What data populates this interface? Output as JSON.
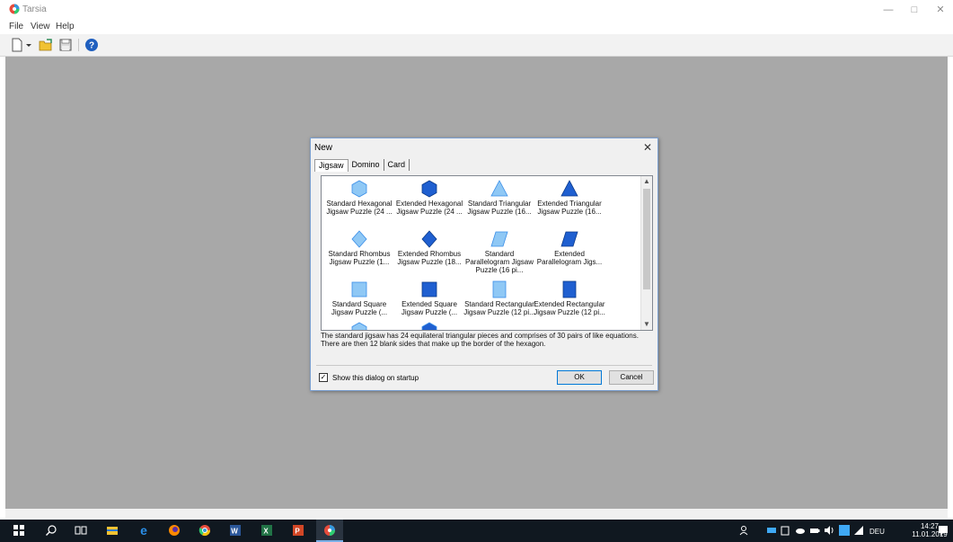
{
  "window": {
    "title": "Tarsia",
    "minimize": "—",
    "maximize": "□",
    "close": "✕"
  },
  "menu": [
    "File",
    "View",
    "Help"
  ],
  "toolbar": {
    "icons": [
      "new-document-icon",
      "dropdown-arrow-icon",
      "open-folder-icon",
      "save-icon",
      "help-icon"
    ]
  },
  "dialog": {
    "title": "New",
    "close": "✕",
    "tabs": [
      "Jigsaw",
      "Domino",
      "Card"
    ],
    "active_tab": "Jigsaw",
    "items": [
      {
        "label": "Standard Hexagonal Jigsaw Puzzle (24 ...",
        "icon": "hexagon-small-icon"
      },
      {
        "label": "Extended Hexagonal Jigsaw Puzzle (24 ...",
        "icon": "hexagon-large-icon"
      },
      {
        "label": "Standard Triangular Jigsaw Puzzle (16...",
        "icon": "triangle-small-icon"
      },
      {
        "label": "Extended Triangular Jigsaw Puzzle (16...",
        "icon": "triangle-large-icon"
      },
      {
        "label": "Standard Rhombus Jigsaw Puzzle (1...",
        "icon": "rhombus-small-icon"
      },
      {
        "label": "Extended Rhombus Jigsaw Puzzle (18...",
        "icon": "rhombus-large-icon"
      },
      {
        "label": "Standard Parallelogram Jigsaw Puzzle (16 pi...",
        "icon": "parallelogram-small-icon"
      },
      {
        "label": "Extended Parallelogram Jigs...",
        "icon": "parallelogram-large-icon"
      },
      {
        "label": "Standard Square Jigsaw Puzzle (...",
        "icon": "square-small-icon"
      },
      {
        "label": "Extended Square Jigsaw Puzzle (...",
        "icon": "square-large-icon"
      },
      {
        "label": "Standard Rectangular Jigsaw Puzzle (12 pi...",
        "icon": "rectangle-small-icon"
      },
      {
        "label": "Extended Rectangular Jigsaw Puzzle (12 pi...",
        "icon": "rectangle-large-icon"
      }
    ],
    "description": "The standard jigsaw has 24 equilateral triangular pieces and comprises of 30 pairs of like equations. There are then 12 blank sides that make up the border of the hexagon.",
    "show_on_startup": {
      "label": "Show this dialog on startup",
      "checked": true
    },
    "ok_label": "OK",
    "cancel_label": "Cancel"
  },
  "taskbar": {
    "apps": [
      "windows-start-icon",
      "search-icon",
      "task-view-icon",
      "file-explorer-icon",
      "edge-icon",
      "firefox-icon",
      "chrome-icon",
      "word-icon",
      "excel-icon",
      "powerpoint-icon",
      "tarsia-icon"
    ],
    "language": "DEU",
    "time": "14:27",
    "date": "11.01.2019"
  },
  "colors": {
    "workspace": "#a8a8a8",
    "taskbar": "#101820",
    "icon_blue": "#3a8ee8"
  }
}
